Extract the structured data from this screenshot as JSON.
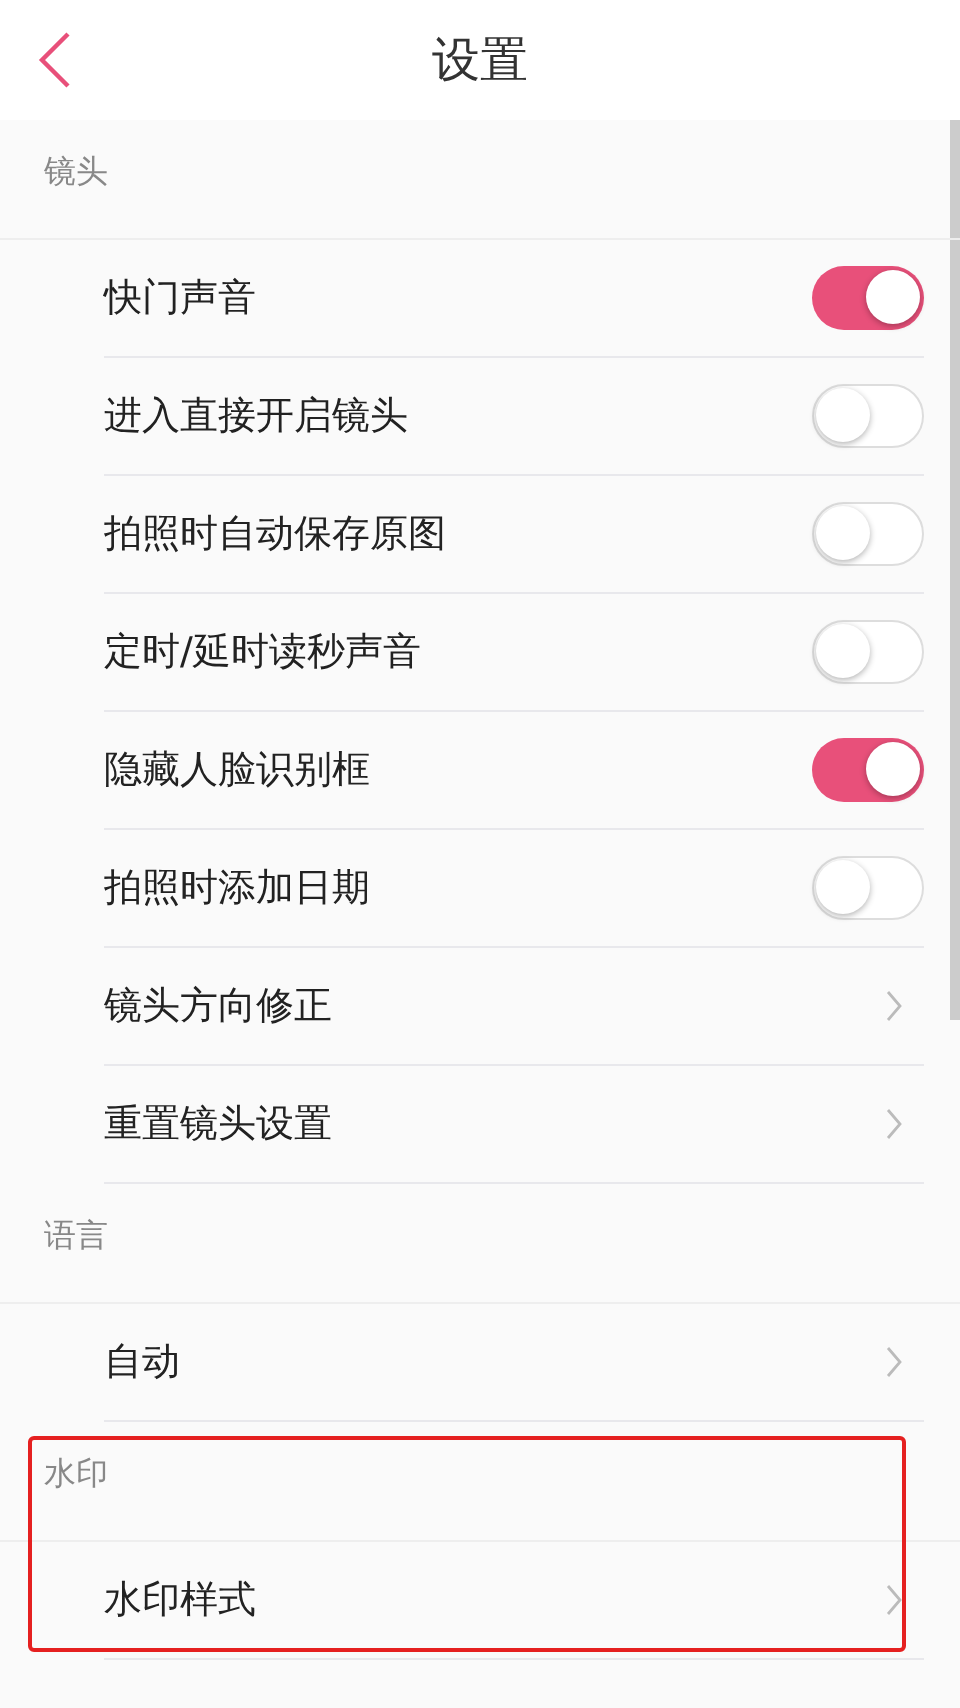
{
  "header": {
    "title": "设置"
  },
  "sections": [
    {
      "title": "镜头",
      "highlighted": false,
      "items": [
        {
          "kind": "toggle",
          "label": "快门声音",
          "on": true
        },
        {
          "kind": "toggle",
          "label": "进入直接开启镜头",
          "on": false
        },
        {
          "kind": "toggle",
          "label": "拍照时自动保存原图",
          "on": false
        },
        {
          "kind": "toggle",
          "label": "定时/延时读秒声音",
          "on": false
        },
        {
          "kind": "toggle",
          "label": "隐藏人脸识别框",
          "on": true
        },
        {
          "kind": "toggle",
          "label": "拍照时添加日期",
          "on": false
        },
        {
          "kind": "link",
          "label": "镜头方向修正"
        },
        {
          "kind": "link",
          "label": "重置镜头设置"
        }
      ]
    },
    {
      "title": "语言",
      "highlighted": false,
      "items": [
        {
          "kind": "link",
          "label": "自动"
        }
      ]
    },
    {
      "title": "水印",
      "highlighted": true,
      "items": [
        {
          "kind": "link",
          "label": "水印样式"
        }
      ]
    }
  ]
}
